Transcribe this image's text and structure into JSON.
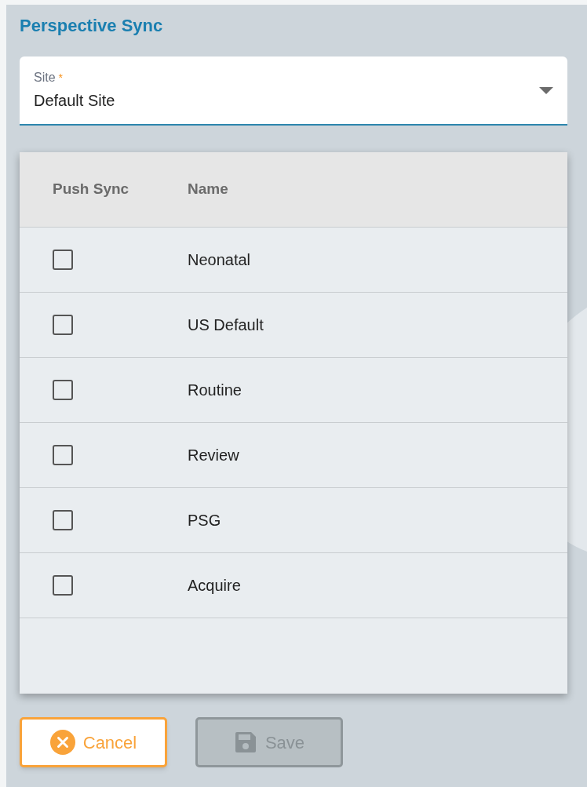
{
  "title": "Perspective Sync",
  "site_field": {
    "label": "Site",
    "required_mark": "*",
    "value": "Default Site"
  },
  "table": {
    "columns": [
      "Push Sync",
      "Name"
    ],
    "rows": [
      {
        "name": "Neonatal",
        "checked": false
      },
      {
        "name": "US Default",
        "checked": false
      },
      {
        "name": "Routine",
        "checked": false
      },
      {
        "name": "Review",
        "checked": false
      },
      {
        "name": "PSG",
        "checked": false
      },
      {
        "name": "Acquire",
        "checked": false
      }
    ]
  },
  "buttons": [
    {
      "kind": "cancel",
      "label": "Cancel",
      "disabled": false
    },
    {
      "kind": "save",
      "label": "Save",
      "disabled": true
    }
  ]
}
